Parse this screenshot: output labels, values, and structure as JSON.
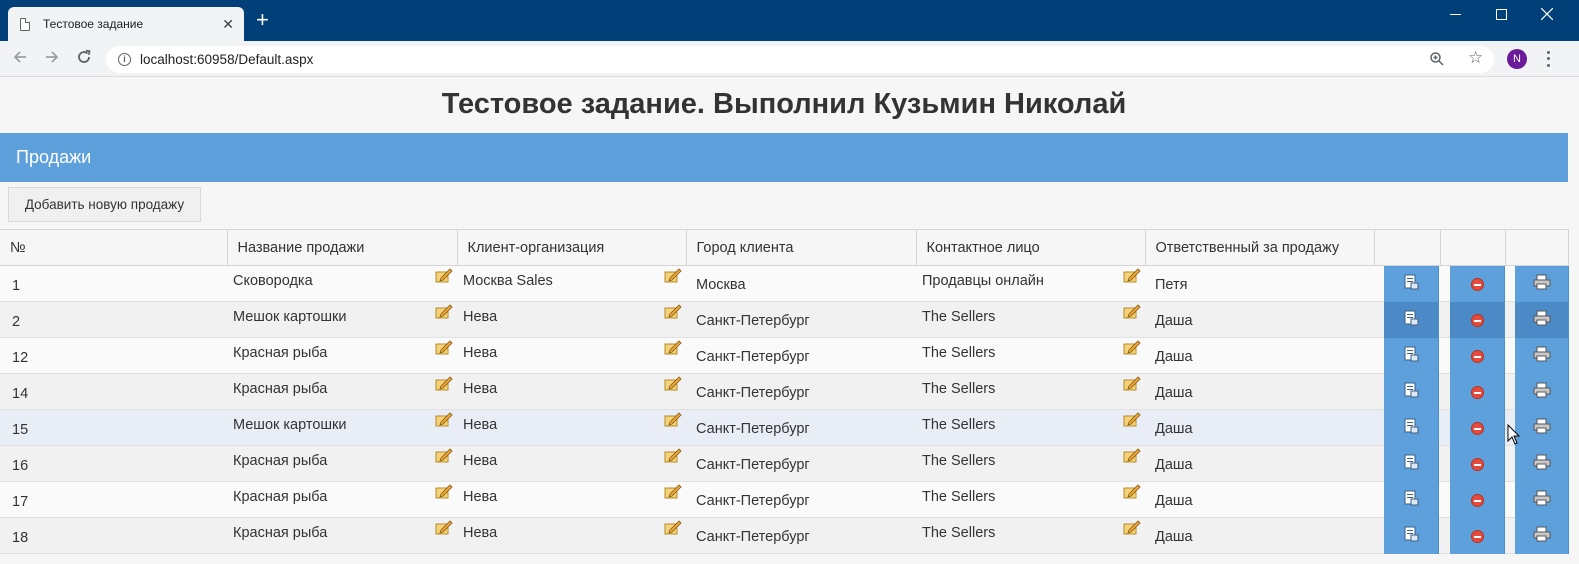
{
  "browser": {
    "tab_title": "Тестовое задание",
    "tab_close": "✕",
    "new_tab": "+",
    "url_host": "localhost:60958/Default.aspx",
    "avatar_letter": "N"
  },
  "page": {
    "title": "Тестовое задание. Выполнил Кузьмин Николай",
    "section_title": "Продажи",
    "add_button": "Добавить новую продажу"
  },
  "table": {
    "columns": [
      "№",
      "Название продажи",
      "Клиент-организация",
      "Город клиента",
      "Контактное лицо",
      "Ответственный за продажу",
      "",
      "",
      ""
    ],
    "rows": [
      {
        "num": "1",
        "sale": "Сковородка",
        "client": "Москва Sales",
        "city": "Москва",
        "contact": "Продавцы онлайн",
        "owner": "Петя"
      },
      {
        "num": "2",
        "sale": "Мешок картошки",
        "client": "Нева",
        "city": "Санкт-Петербург",
        "contact": "The Sellers",
        "owner": "Даша"
      },
      {
        "num": "12",
        "sale": "Красная рыба",
        "client": "Нева",
        "city": "Санкт-Петербург",
        "contact": "The Sellers",
        "owner": "Даша"
      },
      {
        "num": "14",
        "sale": "Красная рыба",
        "client": "Нева",
        "city": "Санкт-Петербург",
        "contact": "The Sellers",
        "owner": "Даша"
      },
      {
        "num": "15",
        "sale": "Мешок картошки",
        "client": "Нева",
        "city": "Санкт-Петербург",
        "contact": "The Sellers",
        "owner": "Даша"
      },
      {
        "num": "16",
        "sale": "Красная рыба",
        "client": "Нева",
        "city": "Санкт-Петербург",
        "contact": "The Sellers",
        "owner": "Даша"
      },
      {
        "num": "17",
        "sale": "Красная рыба",
        "client": "Нева",
        "city": "Санкт-Петербург",
        "contact": "The Sellers",
        "owner": "Даша"
      },
      {
        "num": "18",
        "sale": "Красная рыба",
        "client": "Нева",
        "city": "Санкт-Петербург",
        "contact": "The Sellers",
        "owner": "Даша"
      }
    ]
  },
  "colors": {
    "titlebar": "#003f78",
    "section_bar": "#5ea0db",
    "action_button": "#5ea0db",
    "delete_icon": "#e54b3c"
  },
  "icons": {
    "row_edit": "pencil-note-icon",
    "row_open": "document-icon",
    "row_delete": "delete-icon",
    "row_print": "printer-icon"
  }
}
